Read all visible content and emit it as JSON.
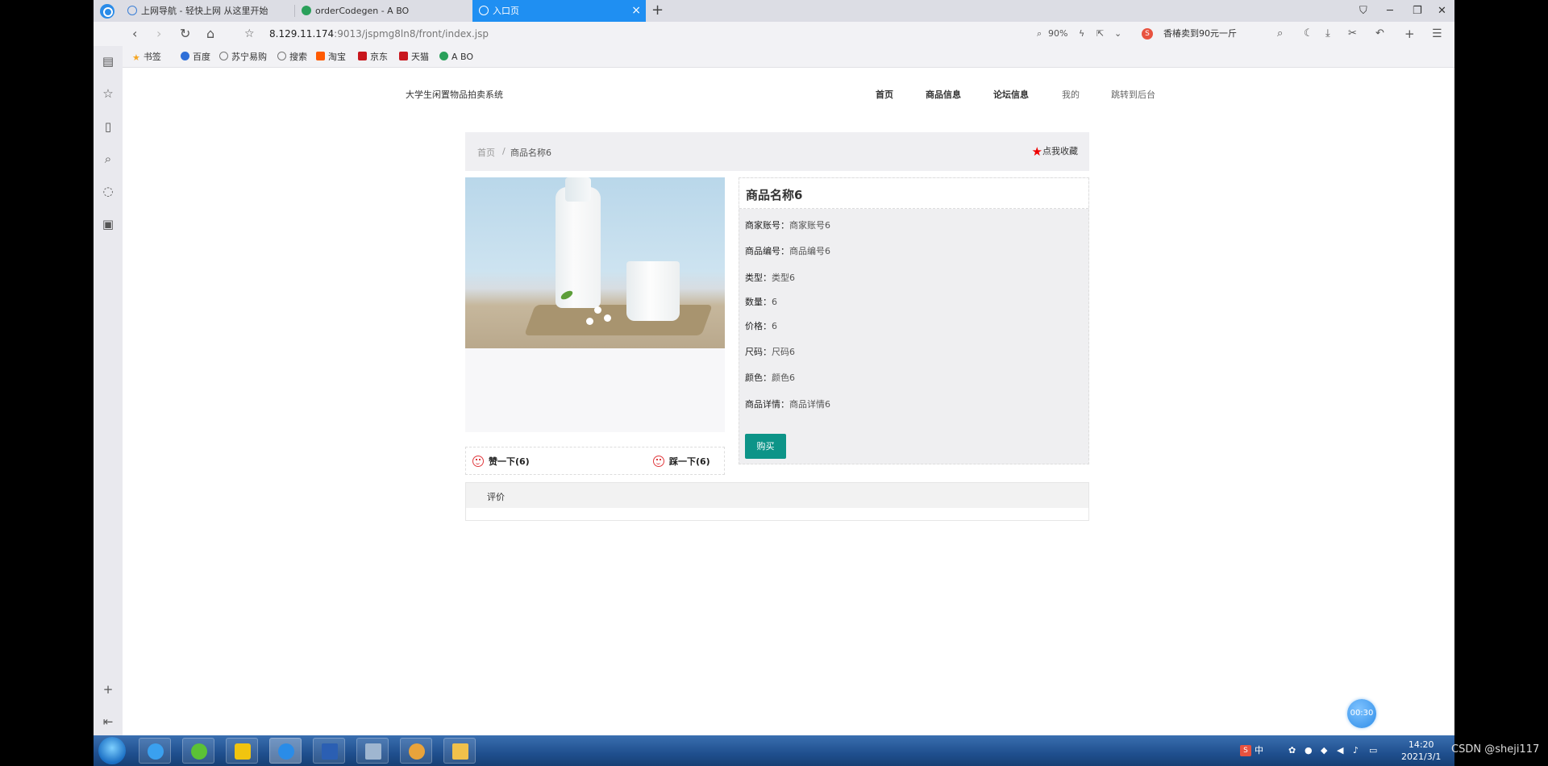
{
  "browser": {
    "tabs": [
      {
        "label": "上网导航 - 轻快上网 从这里开始"
      },
      {
        "label": "orderCodegen - A BO"
      },
      {
        "label": "入口页"
      }
    ],
    "new_tab": "+",
    "url_host": "8.129.11.174",
    "url_path": ":9013/jspmg8ln8/front/index.jsp",
    "zoom": "90%",
    "search_text": "香椿卖到90元一斤",
    "win_controls": {
      "minimize": "─",
      "restore": "❐",
      "close": "✕"
    }
  },
  "bookmarks": [
    {
      "label": "书签",
      "icon": "star-icon",
      "color": "#f5a623"
    },
    {
      "label": "百度",
      "icon": "baidu-icon",
      "color": "#2e6fd8"
    },
    {
      "label": "苏宁易购",
      "icon": "globe-icon",
      "color": "#777777"
    },
    {
      "label": "搜索",
      "icon": "globe-icon",
      "color": "#777777"
    },
    {
      "label": "淘宝",
      "icon": "taobao-icon",
      "color": "#ff5a00"
    },
    {
      "label": "京东",
      "icon": "jd-icon",
      "color": "#c8161d"
    },
    {
      "label": "天猫",
      "icon": "tmall-icon",
      "color": "#c8161d"
    },
    {
      "label": "A BO",
      "icon": "abo-icon",
      "color": "#2aa05a"
    }
  ],
  "site": {
    "title": "大学生闲置物品拍卖系统",
    "nav": [
      "首页",
      "商品信息",
      "论坛信息",
      "我的",
      "跳转到后台"
    ]
  },
  "breadcrumb": {
    "home": "首页",
    "sep": "/",
    "current": "商品名称6"
  },
  "favorite_label": "点我收藏",
  "product": {
    "name": "商品名称6",
    "fields": [
      {
        "label": "商家账号：",
        "value": "商家账号6"
      },
      {
        "label": "商品编号：",
        "value": "商品编号6"
      },
      {
        "label": "类型：",
        "value": "类型6"
      },
      {
        "label": "数量：",
        "value": "6"
      },
      {
        "label": "价格：",
        "value": "6"
      },
      {
        "label": "尺码：",
        "value": "尺码6"
      },
      {
        "label": "颜色：",
        "value": "颜色6"
      },
      {
        "label": "商品详情：",
        "value": "商品详情6"
      }
    ],
    "buy_label": "购买",
    "like_label": "赞一下(6)",
    "dislike_label": "踩一下(6)"
  },
  "review_title": "评价",
  "timer": "00:30",
  "taskbar": {
    "ime": "中",
    "time": "14:20",
    "date": "2021/3/1"
  },
  "watermark": "CSDN @sheji117",
  "colors": {
    "accent": "#0d9488",
    "tab_active": "#1f8ff2",
    "star": "#ee0000"
  }
}
